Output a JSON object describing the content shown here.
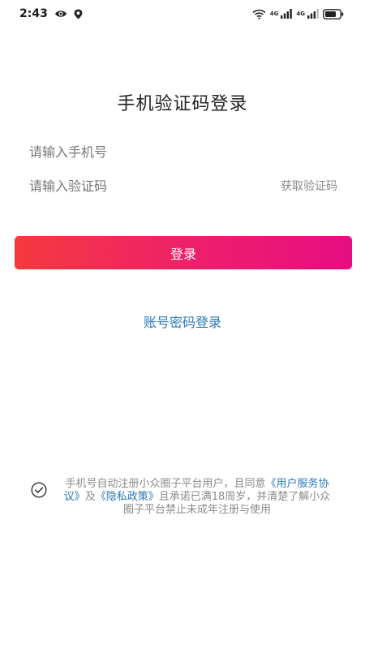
{
  "status_bar": {
    "time": "2:43",
    "sim1_label": "4G",
    "sim2_label": "4G"
  },
  "login": {
    "title": "手机验证码登录",
    "phone_placeholder": "请输入手机号",
    "code_placeholder": "请输入验证码",
    "get_code_label": "获取验证码",
    "login_button_label": "登录",
    "password_login_label": "账号密码登录"
  },
  "agreement": {
    "text_part1": "手机号自动注册小众圈子平台用户，且同意",
    "user_agreement_link": "《用户服务协议》",
    "text_part2": "及",
    "privacy_link": "《隐私政策》",
    "text_part3": "且承诺已满18周岁，并清楚了解小众圈子平台禁止未成年注册与使用",
    "checked": true
  },
  "colors": {
    "gradient_start": "#f43a3f",
    "gradient_end": "#e70d83",
    "link": "#2a78b8",
    "muted_text": "#8a8a8a"
  },
  "icons": [
    "eye-icon",
    "location-icon",
    "wifi-icon",
    "signal-icon",
    "battery-icon",
    "check-circle-icon"
  ]
}
